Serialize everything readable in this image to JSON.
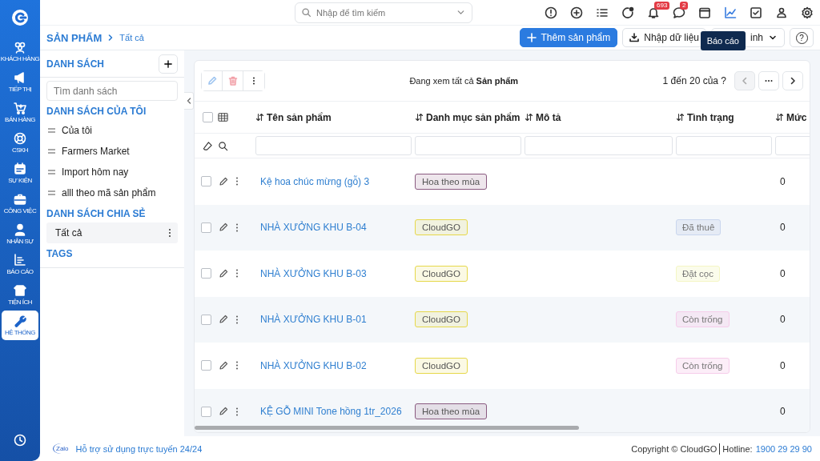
{
  "nav": {
    "items": [
      {
        "kind": "customers",
        "label": "KHÁCH HÀNG",
        "selected": false
      },
      {
        "kind": "marketing",
        "label": "TIẾP THỊ",
        "selected": false
      },
      {
        "kind": "sales",
        "label": "BÁN HÀNG",
        "selected": false
      },
      {
        "kind": "support",
        "label": "CSKH",
        "selected": false
      },
      {
        "kind": "events",
        "label": "SỰ KIỆN",
        "selected": false
      },
      {
        "kind": "work",
        "label": "CÔNG VIỆC",
        "selected": false
      },
      {
        "kind": "staff",
        "label": "NHÂN SỰ",
        "selected": false
      },
      {
        "kind": "reports",
        "label": "BÁO CÁO",
        "selected": false
      },
      {
        "kind": "utilities",
        "label": "TIỆN ÍCH",
        "selected": false
      },
      {
        "kind": "system",
        "label": "HỆ THỐNG",
        "selected": true
      }
    ]
  },
  "search": {
    "placeholder": "Nhập để tìm kiếm"
  },
  "toolbar_icons": [
    {
      "kind": "alert",
      "selected": false
    },
    {
      "kind": "add",
      "selected": false
    },
    {
      "kind": "list",
      "selected": false
    },
    {
      "kind": "activity",
      "selected": false
    },
    {
      "kind": "bell",
      "badge": "693",
      "selected": false
    },
    {
      "kind": "chat",
      "badge": "2",
      "selected": false
    },
    {
      "kind": "calendar",
      "selected": false
    },
    {
      "kind": "chart",
      "selected": true
    },
    {
      "kind": "task",
      "selected": false
    },
    {
      "kind": "user",
      "selected": false
    },
    {
      "kind": "settings",
      "selected": false
    }
  ],
  "tooltip": "Báo cáo",
  "breadcrumb": {
    "title": "SẢN PHẨM",
    "current": "Tất cả"
  },
  "actions": [
    {
      "kind": "primary",
      "label": "Thêm sản phẩm"
    },
    {
      "kind": "import",
      "label": "Nhập dữ liệu"
    },
    {
      "kind": "dropdown",
      "label": "inh"
    },
    {
      "kind": "help",
      "label": "?"
    }
  ],
  "lists_panel": {
    "title": "DANH SÁCH",
    "search": {
      "placeholder": "Tìm danh sách"
    },
    "sections": [
      {
        "title": "DANH SÁCH CỦA TÔI",
        "items": [
          {
            "label": "Của tôi",
            "selected": false
          },
          {
            "label": "Farmers Market",
            "selected": false
          },
          {
            "label": "Import hôm nay",
            "selected": false
          },
          {
            "label": "alll theo mã sản phẩm",
            "selected": false
          }
        ]
      },
      {
        "title": "DANH SÁCH CHIA SẺ",
        "items": [
          {
            "label": "Tất cả",
            "selected": true
          }
        ]
      },
      {
        "title": "TAGS"
      }
    ]
  },
  "table": {
    "all_checked": false,
    "summary": "Đang xem tất cả **Sản phẩm**",
    "pagination": "1 đến 20 của ?",
    "columns": [
      "Tên sản phẩm",
      "Danh mục sản phẩm",
      "Mô tả",
      "Tình trạng",
      "Mức"
    ],
    "rows": [
      {
        "checked": false,
        "name": "Kệ hoa chúc mừng (gỗ) 3",
        "category": {
          "label": "Hoa theo mùa",
          "color": "#8a5a80"
        },
        "column_5": "0"
      },
      {
        "checked": false,
        "name": "NHÀ XƯỞNG KHU B-04",
        "category": {
          "label": "CloudGO",
          "color": "#e6d84a"
        },
        "status": {
          "label": "Đã thuê",
          "color": "#c9d6ee"
        },
        "column_5": "0"
      },
      {
        "checked": false,
        "name": "NHÀ XƯỞNG KHU B-03",
        "category": {
          "label": "CloudGO",
          "color": "#e6d84a"
        },
        "status": {
          "label": "Đặt cọc",
          "color": "#f4f6c4"
        },
        "column_5": "0"
      },
      {
        "checked": false,
        "name": "NHÀ XƯỞNG KHU B-01",
        "category": {
          "label": "CloudGO",
          "color": "#e6d84a"
        },
        "status": {
          "label": "Còn trống",
          "color": "#f6cdea"
        },
        "column_5": "0"
      },
      {
        "checked": false,
        "name": "NHÀ XƯỞNG KHU B-02",
        "category": {
          "label": "CloudGO",
          "color": "#e6d84a"
        },
        "status": {
          "label": "Còn trống",
          "color": "#f6cdea"
        },
        "column_5": "0"
      },
      {
        "checked": false,
        "name": "KỆ GỖ MINI Tone hồng 1tr_2026",
        "category": {
          "label": "Hoa theo mùa",
          "color": "#8a5a80"
        },
        "column_5": "0"
      }
    ]
  },
  "footer": {
    "zalo": "Zalo",
    "support": "Hỗ trợ sử dụng trực tuyến 24/24",
    "copyright": "Copyright © CloudGO",
    "hotline_label": "Hotline:",
    "hotline": "1900 29 29 90"
  }
}
